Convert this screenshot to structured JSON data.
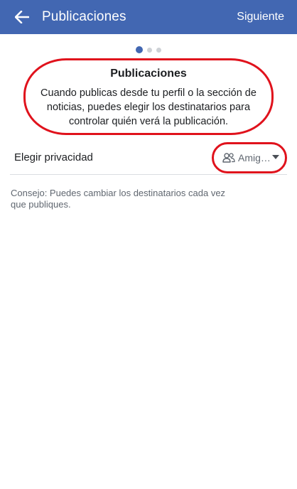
{
  "header": {
    "title": "Publicaciones",
    "next_label": "Siguiente"
  },
  "pager": {
    "current": 1,
    "total": 3
  },
  "intro": {
    "title": "Publicaciones",
    "body": "Cuando publicas desde tu perfil o la sección de noticias, puedes elegir los destinatarios para controlar quién verá la publicación."
  },
  "privacy": {
    "label": "Elegir privacidad",
    "selected": "Amig…",
    "icon": "friends-icon"
  },
  "tip": "Consejo: Puedes cambiar los destinatarios cada vez que publiques.",
  "colors": {
    "brand": "#4267b2",
    "highlight": "#e0121c",
    "text": "#1c1e21",
    "secondary_text": "#606770"
  }
}
